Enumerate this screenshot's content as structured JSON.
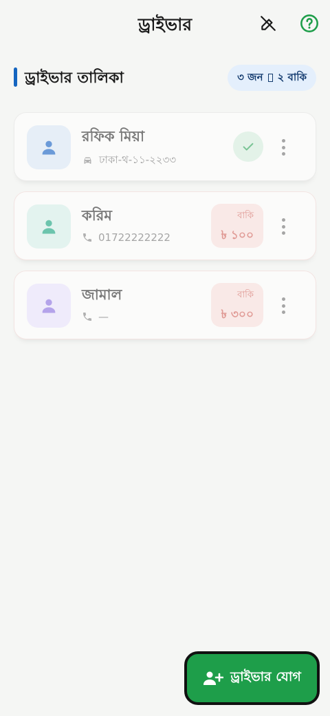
{
  "appbar": {
    "title": "ড্রাইভার",
    "icons": [
      "edit-off-icon",
      "help-icon"
    ],
    "accent": "#1e9e4a"
  },
  "section": {
    "title": "ড্রাইভার তালিকা",
    "summary_count": "৩ জন",
    "summary_due": "২ বাকি",
    "accent": "#1565c0"
  },
  "drivers": [
    {
      "name": "রফিক মিয়া",
      "detail_icon": "car-icon",
      "detail": "ঢাকা-থ-১১-২২৩৩",
      "status": "ok",
      "avatar_bg": "#e6eef7",
      "avatar_color": "#6b9ad8"
    },
    {
      "name": "করিম",
      "detail_icon": "phone-icon",
      "detail": "01722222222",
      "status": "due",
      "due_label": "বাকি",
      "due_amount": "৳ ১০০",
      "avatar_bg": "#e3f3ef",
      "avatar_color": "#6cc4ad"
    },
    {
      "name": "জামাল",
      "detail_icon": "phone-icon",
      "detail": "—",
      "status": "due",
      "due_label": "বাকি",
      "due_amount": "৳ ৩০০",
      "avatar_bg": "#efebfb",
      "avatar_color": "#b4a3ea"
    }
  ],
  "fab": {
    "label": "ড্রাইভার যোগ",
    "icon": "person-add-icon",
    "color": "#1e9e4a"
  }
}
